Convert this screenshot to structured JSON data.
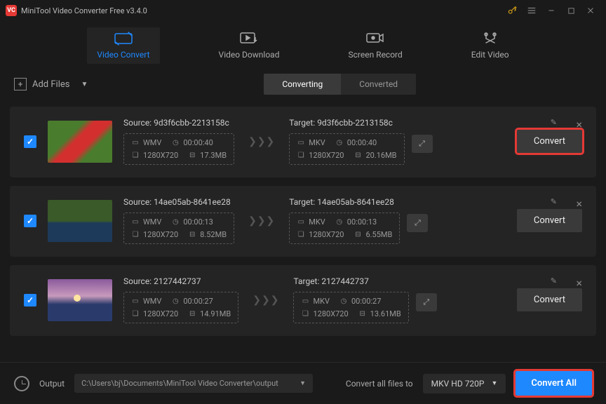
{
  "app": {
    "title": "MiniTool Video Converter Free v3.4.0"
  },
  "main_tabs": [
    {
      "label": "Video Convert"
    },
    {
      "label": "Video Download"
    },
    {
      "label": "Screen Record"
    },
    {
      "label": "Edit Video"
    }
  ],
  "toolbar": {
    "add_files": "Add Files"
  },
  "sub_tabs": {
    "converting": "Converting",
    "converted": "Converted"
  },
  "files": [
    {
      "checked": true,
      "source_label": "Source:",
      "source_name": "9d3f6cbb-2213158c",
      "target_label": "Target:",
      "target_name": "9d3f6cbb-2213158c",
      "src_fmt": "WMV",
      "src_dur": "00:00:40",
      "src_res": "1280X720",
      "src_size": "17.3MB",
      "tgt_fmt": "MKV",
      "tgt_dur": "00:00:40",
      "tgt_res": "1280X720",
      "tgt_size": "20.16MB",
      "convert": "Convert"
    },
    {
      "checked": true,
      "source_label": "Source:",
      "source_name": "14ae05ab-8641ee28",
      "target_label": "Target:",
      "target_name": "14ae05ab-8641ee28",
      "src_fmt": "WMV",
      "src_dur": "00:00:13",
      "src_res": "1280X720",
      "src_size": "8.52MB",
      "tgt_fmt": "MKV",
      "tgt_dur": "00:00:13",
      "tgt_res": "1280X720",
      "tgt_size": "6.55MB",
      "convert": "Convert"
    },
    {
      "checked": true,
      "source_label": "Source:",
      "source_name": "2127442737",
      "target_label": "Target:",
      "target_name": "2127442737",
      "src_fmt": "WMV",
      "src_dur": "00:00:27",
      "src_res": "1280X720",
      "src_size": "14.91MB",
      "tgt_fmt": "MKV",
      "tgt_dur": "00:00:27",
      "tgt_res": "1280X720",
      "tgt_size": "13.61MB",
      "convert": "Convert"
    }
  ],
  "bottom": {
    "output_label": "Output",
    "output_path": "C:\\Users\\bj\\Documents\\MiniTool Video Converter\\output",
    "convert_all_label": "Convert all files to",
    "format": "MKV HD 720P",
    "convert_all": "Convert All"
  }
}
